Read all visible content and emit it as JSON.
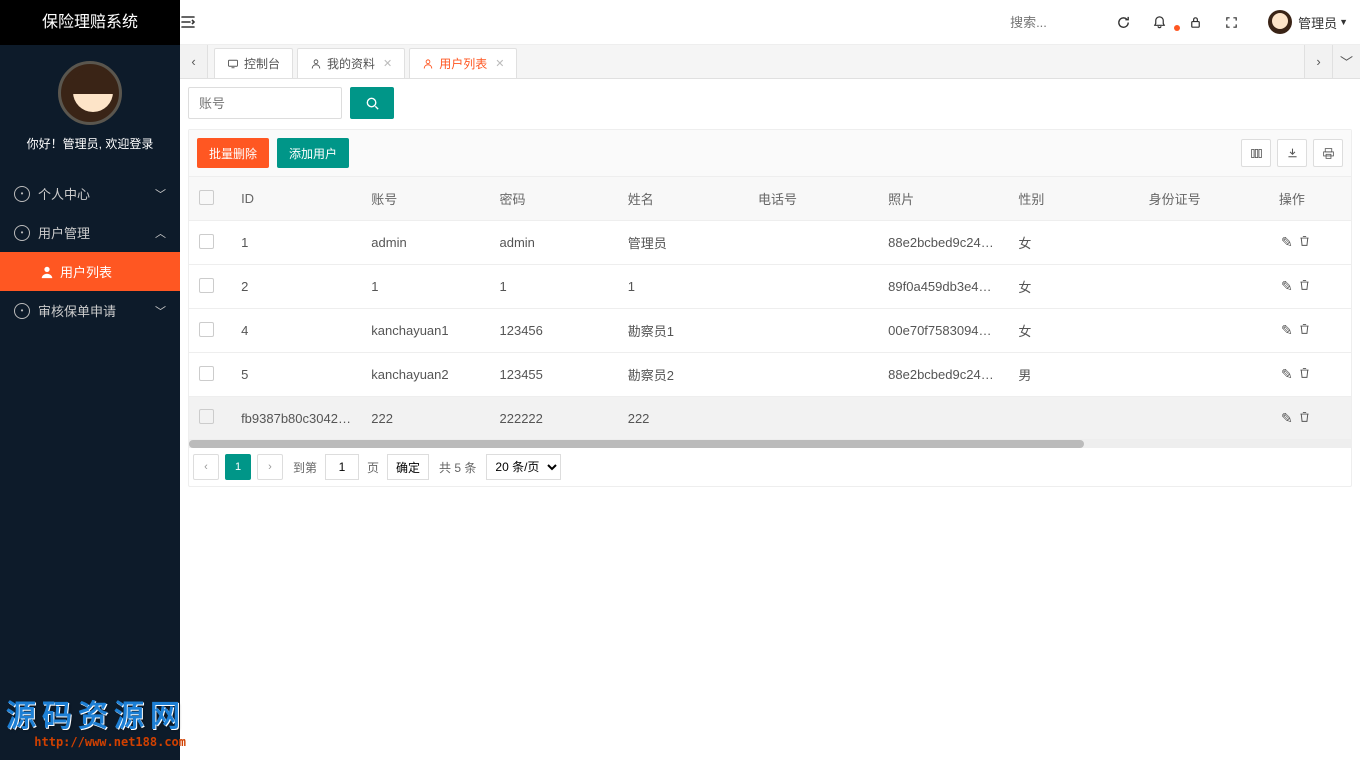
{
  "brand": "保险理赔系统",
  "greeting": "你好！管理员, 欢迎登录",
  "sidebar": {
    "items": [
      {
        "label": "个人中心",
        "expanded": false
      },
      {
        "label": "用户管理",
        "expanded": true
      },
      {
        "label": "审核保单申请",
        "expanded": false
      }
    ],
    "sub_active": "用户列表"
  },
  "topbar": {
    "search_placeholder": "搜索...",
    "user_label": "管理员"
  },
  "tabs": {
    "items": [
      {
        "label": "控制台",
        "closable": false,
        "active": false,
        "icon": "monitor"
      },
      {
        "label": "我的资料",
        "closable": true,
        "active": false,
        "icon": "person"
      },
      {
        "label": "用户列表",
        "closable": true,
        "active": true,
        "icon": "person"
      }
    ]
  },
  "filter": {
    "placeholder": "账号"
  },
  "toolbar": {
    "bulk_delete": "批量删除",
    "add_user": "添加用户"
  },
  "table": {
    "headers": [
      "ID",
      "账号",
      "密码",
      "姓名",
      "电话号",
      "照片",
      "性别",
      "身份证号",
      "操作"
    ],
    "rows": [
      {
        "id": "1",
        "acct": "admin",
        "pwd": "admin",
        "name": "管理员",
        "phone": "",
        "photo": "88e2bcbed9c245...",
        "gender": "女",
        "idcard": ""
      },
      {
        "id": "2",
        "acct": "1",
        "pwd": "1",
        "name": "1",
        "phone": "",
        "photo": "89f0a459db3e42c...",
        "gender": "女",
        "idcard": ""
      },
      {
        "id": "4",
        "acct": "kanchayuan1",
        "pwd": "123456",
        "name": "勘察员1",
        "phone": "",
        "photo": "00e70f758309438...",
        "gender": "女",
        "idcard": ""
      },
      {
        "id": "5",
        "acct": "kanchayuan2",
        "pwd": "123455",
        "name": "勘察员2",
        "phone": "",
        "photo": "88e2bcbed9c245...",
        "gender": "男",
        "idcard": ""
      },
      {
        "id": "fb9387b80c30421...",
        "acct": "222",
        "pwd": "222222",
        "name": "222",
        "phone": "",
        "photo": "",
        "gender": "",
        "idcard": ""
      }
    ]
  },
  "pager": {
    "current": "1",
    "goto_label": "到第",
    "page_suffix": "页",
    "goto_value": "1",
    "confirm": "确定",
    "total": "共 5 条",
    "perpage": "20 条/页"
  },
  "watermark": {
    "text": "源码资源网",
    "url": "http://www.net188.com"
  }
}
